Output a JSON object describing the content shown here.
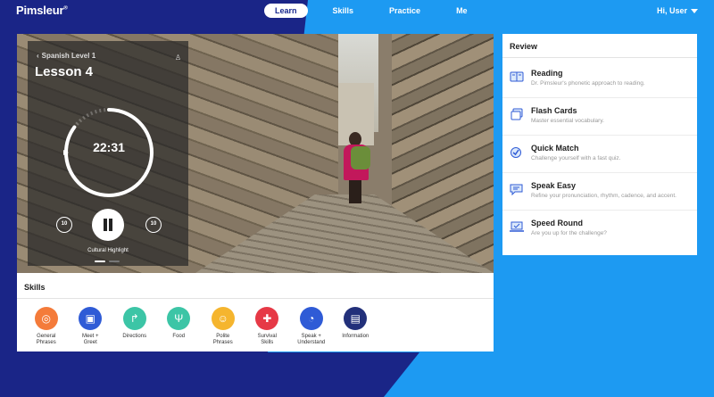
{
  "header": {
    "logo": "Pimsleur",
    "logo_mark": "®",
    "nav": [
      {
        "label": "Learn",
        "active": true
      },
      {
        "label": "Skills",
        "active": false
      },
      {
        "label": "Practice",
        "active": false
      },
      {
        "label": "Me",
        "active": false
      }
    ],
    "user_label": "Hi, User"
  },
  "player": {
    "course": "Spanish Level 1",
    "lesson": "Lesson 4",
    "time_remaining": "22:31",
    "progress_fraction": 0.85,
    "skip_back_seconds": "10",
    "skip_forward_seconds": "10",
    "highlight_label": "Cultural Highlight",
    "slide_count": 2,
    "active_slide": 0
  },
  "skills": {
    "title": "Skills",
    "items": [
      {
        "label": "General\nPhrases",
        "color": "#f47b3a",
        "icon": "globe-icon",
        "glyph": "◎"
      },
      {
        "label": "Meet +\nGreet",
        "color": "#2f5bd6",
        "icon": "id-card-icon",
        "glyph": "▣"
      },
      {
        "label": "Directions",
        "color": "#3cc5a6",
        "icon": "arrow-turn-icon",
        "glyph": "↱"
      },
      {
        "label": "Food",
        "color": "#3cc5a6",
        "icon": "utensils-icon",
        "glyph": "Ψ"
      },
      {
        "label": "Polite\nPhrases",
        "color": "#f5b52e",
        "icon": "smile-icon",
        "glyph": "☺"
      },
      {
        "label": "Survival\nSkills",
        "color": "#e63946",
        "icon": "first-aid-icon",
        "glyph": "✚"
      },
      {
        "label": "Speak +\nUnderstand",
        "color": "#2f5bd6",
        "icon": "head-speech-icon",
        "glyph": "◔"
      },
      {
        "label": "Information",
        "color": "#22307a",
        "icon": "info-book-icon",
        "glyph": "▤"
      }
    ]
  },
  "review": {
    "title": "Review",
    "items": [
      {
        "title": "Reading",
        "desc": "Dr. Pimsleur's phonetic approach to reading.",
        "icon": "book-icon"
      },
      {
        "title": "Flash Cards",
        "desc": "Master essential vocabulary.",
        "icon": "cards-icon"
      },
      {
        "title": "Quick Match",
        "desc": "Challenge yourself with a fast quiz.",
        "icon": "check-circle-icon"
      },
      {
        "title": "Speak Easy",
        "desc": "Refine your pronunciation, rhythm, cadence, and accent.",
        "icon": "speech-bubble-icon"
      },
      {
        "title": "Speed Round",
        "desc": "Are you up for the challenge?",
        "icon": "laptop-check-icon"
      }
    ]
  }
}
